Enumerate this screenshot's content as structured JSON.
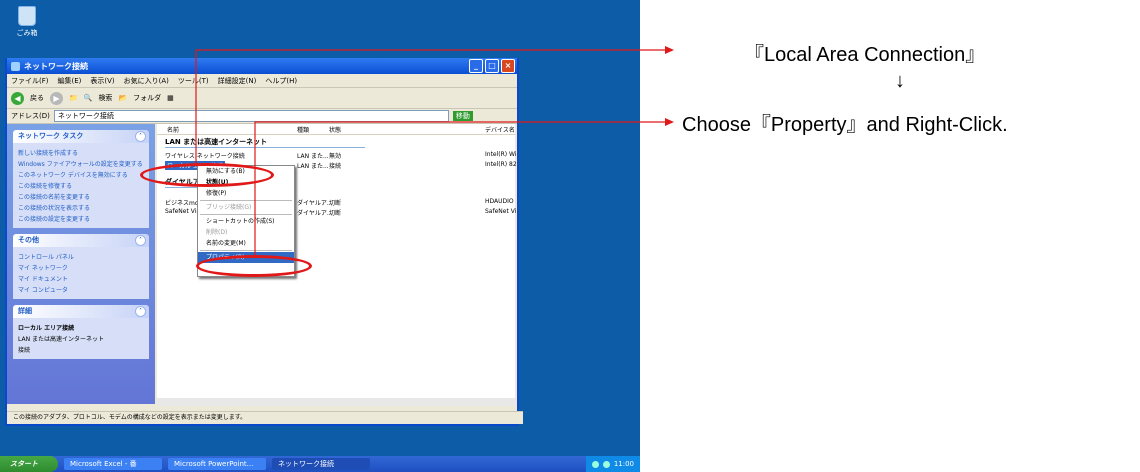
{
  "desktop": {
    "recycle_bin_label": "ごみ箱",
    "window": {
      "title": "ネットワーク接続",
      "menu": [
        "ファイル(F)",
        "編集(E)",
        "表示(V)",
        "お気に入り(A)",
        "ツール(T)",
        "詳細設定(N)",
        "ヘルプ(H)"
      ],
      "toolbar": {
        "back": "戻る",
        "search": "検索",
        "folders": "フォルダ"
      },
      "address": {
        "label": "アドレス(D)",
        "value": "ネットワーク接続",
        "go": "移動"
      },
      "tasks_panel": {
        "title": "ネットワーク タスク",
        "items": [
          "新しい接続を作成する",
          "Windows ファイアウォールの設定を変更する",
          "このネットワーク デバイスを無効にする",
          "この接続を修復する",
          "この接続の名前を変更する",
          "この接続の状況を表示する",
          "この接続の設定を変更する"
        ]
      },
      "other_panel": {
        "title": "その他",
        "items": [
          "コントロール パネル",
          "マイ ネットワーク",
          "マイ ドキュメント",
          "マイ コンピュータ"
        ]
      },
      "details_panel": {
        "title": "詳細",
        "name": "ローカル エリア接続",
        "line1": "LAN または高速インターネット",
        "line2": "接続"
      },
      "columns": {
        "name": "名前",
        "type": "種類",
        "status": "状態",
        "device": "デバイス名"
      },
      "group_lan": "LAN または高速インターネット",
      "lan_rows": [
        {
          "name": "ワイヤレス ネットワーク接続",
          "type": "LAN また...",
          "status": "無効",
          "device": "Intel(R) Wi"
        },
        {
          "name": "ローカル エリア接続",
          "type": "LAN また...",
          "status": "接続",
          "device": "Intel(R) 82"
        }
      ],
      "group_dialup": "ダイヤルアップ",
      "dialup_rows": [
        {
          "name": "ビジネスmopera",
          "type": "ダイヤルア...",
          "status": "切断",
          "device": "HDAUDIO"
        },
        {
          "name": "SafeNet Virtu",
          "type": "ダイヤルア...",
          "status": "切断",
          "device": "SafeNet Vi"
        }
      ],
      "context_menu": [
        "無効にする(B)",
        "状態(U)",
        "修復(P)",
        "ブリッジ接続(G)",
        "ショートカットの作成(S)",
        "削除(D)",
        "名前の変更(M)",
        "プロパティ(R)"
      ],
      "status_bar": "この接続のアダプタ、プロトコル、モデムの構成などの設定を表示または変更します。"
    },
    "taskbar": {
      "start": "スタート",
      "tasks": [
        "Microsoft Excel - 番",
        "Microsoft PowerPoint...",
        "ネットワーク接続"
      ],
      "clock": "11:00"
    }
  },
  "annotations": {
    "line1": "『Local Area Connection』",
    "arrow": "↓",
    "line2": "Choose『Property』and Right-Click.",
    "accent_color": "#e01818"
  }
}
